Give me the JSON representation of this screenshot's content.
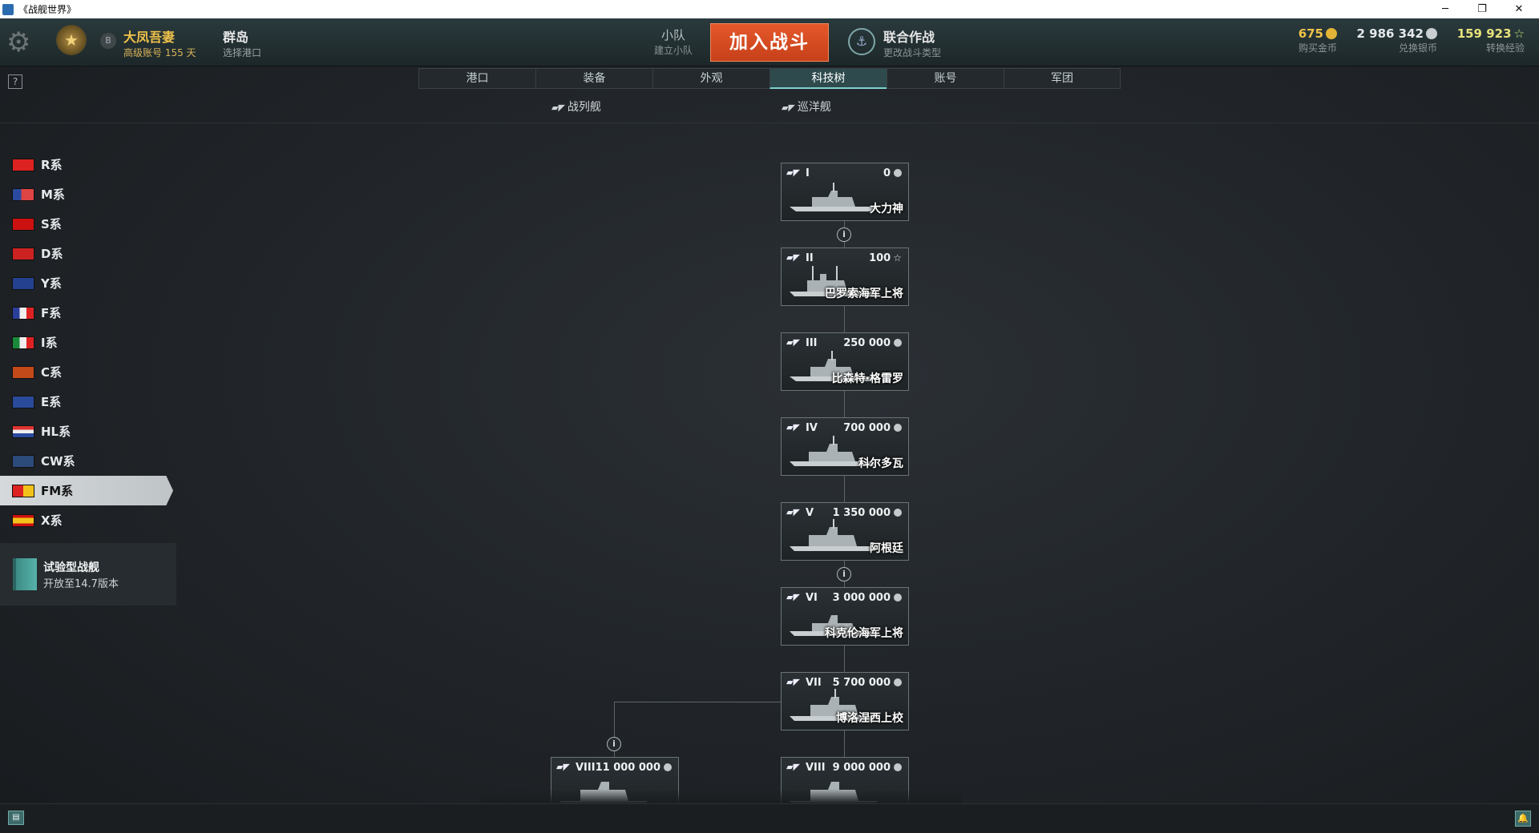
{
  "window": {
    "title": "《战舰世界》"
  },
  "header": {
    "player_name": "大凤吾妻",
    "player_sub": "高级账号  155 天",
    "rank_badge": "B",
    "port_name": "群岛",
    "port_sub": "选择港口",
    "squad_name": "小队",
    "squad_sub": "建立小队",
    "battle_button": "加入战斗",
    "mode_name": "联合作战",
    "mode_sub": "更改战斗类型",
    "gold_value": "675",
    "gold_label": "购买金币",
    "silver_value": "2 986 342",
    "silver_label": "兑换银币",
    "xp_value": "159 923",
    "xp_label": "转换经验",
    "colors": {
      "gold": "#f0c24a",
      "silver": "#d8dde2",
      "xp": "#e8e27a",
      "battle": "#d64a21"
    }
  },
  "help_label": "?",
  "tabs": [
    {
      "label": "港口",
      "active": false
    },
    {
      "label": "装备",
      "active": false
    },
    {
      "label": "外观",
      "active": false
    },
    {
      "label": "科技树",
      "active": true
    },
    {
      "label": "账号",
      "active": false
    },
    {
      "label": "军团",
      "active": false
    }
  ],
  "ship_classes": [
    {
      "label": "战列舰"
    },
    {
      "label": "巡洋舰"
    }
  ],
  "nations": [
    {
      "label": "R系",
      "flag": "red-flag"
    },
    {
      "label": "M系",
      "flag": "us-flag"
    },
    {
      "label": "S系",
      "flag": "soviet-flag"
    },
    {
      "label": "D系",
      "flag": "german-flag"
    },
    {
      "label": "Y系",
      "flag": "uk-flag"
    },
    {
      "label": "F系",
      "flag": "french-flag"
    },
    {
      "label": "I系",
      "flag": "italian-flag"
    },
    {
      "label": "C系",
      "flag": "pan-asian-flag"
    },
    {
      "label": "E系",
      "flag": "european-flag"
    },
    {
      "label": "HL系",
      "flag": "dutch-flag"
    },
    {
      "label": "CW系",
      "flag": "commonwealth-flag"
    },
    {
      "label": "FM系",
      "flag": "pan-american-flag",
      "active": true
    },
    {
      "label": "X系",
      "flag": "spanish-flag"
    }
  ],
  "test_ships": {
    "title": "试验型战舰",
    "subtitle": "开放至14.7版本"
  },
  "tech_tree": {
    "ships": [
      {
        "tier": "I",
        "cost": "0",
        "currency": "silver",
        "name": "大力神"
      },
      {
        "tier": "II",
        "cost": "100",
        "currency": "xp",
        "name": "巴罗索海军上将"
      },
      {
        "tier": "III",
        "cost": "250 000",
        "currency": "silver",
        "name": "比森特·格雷罗"
      },
      {
        "tier": "IV",
        "cost": "700 000",
        "currency": "silver",
        "name": "科尔多瓦"
      },
      {
        "tier": "V",
        "cost": "1 350 000",
        "currency": "silver",
        "name": "阿根廷"
      },
      {
        "tier": "VI",
        "cost": "3 000 000",
        "currency": "silver",
        "name": "科克伦海军上将"
      },
      {
        "tier": "VII",
        "cost": "5 700 000",
        "currency": "silver",
        "name": "博洛涅西上校"
      },
      {
        "tier": "VIII",
        "cost": "9 000 000",
        "currency": "silver",
        "name": ""
      },
      {
        "tier": "VIII",
        "cost": "11 000 000",
        "currency": "silver",
        "name": ""
      }
    ],
    "info_label": "i"
  },
  "bottom": {
    "chat_icon": "chat-icon",
    "notification_icon": "bell-icon"
  }
}
